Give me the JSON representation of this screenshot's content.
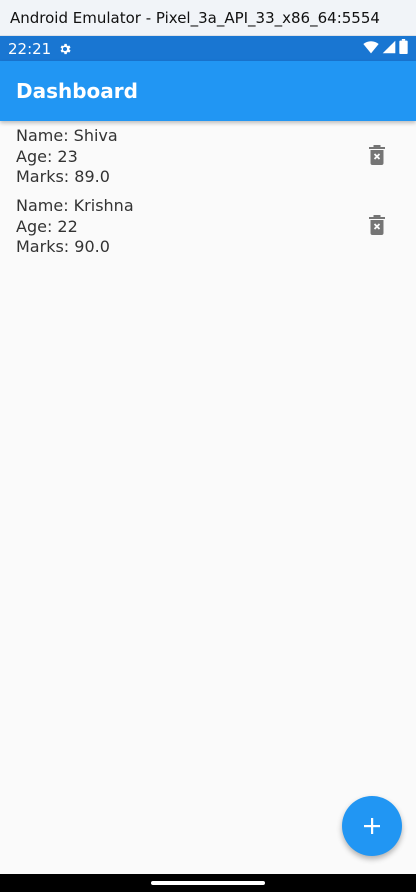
{
  "window": {
    "title": "Android Emulator - Pixel_3a_API_33_x86_64:5554"
  },
  "status_bar": {
    "time": "22:21",
    "icons": [
      "settings-gear-icon",
      "wifi-icon",
      "signal-icon",
      "battery-icon"
    ]
  },
  "app_bar": {
    "title": "Dashboard"
  },
  "students": [
    {
      "name": "Name: Shiva",
      "age": "Age: 23",
      "marks": "Marks: 89.0"
    },
    {
      "name": "Name: Krishna",
      "age": "Age: 22",
      "marks": "Marks: 90.0"
    }
  ],
  "fab": {
    "icon": "add-icon"
  },
  "colors": {
    "primary": "#2196f3",
    "status_bar": "#1976d2",
    "background": "#fafafa",
    "icon_grey": "#757575"
  }
}
